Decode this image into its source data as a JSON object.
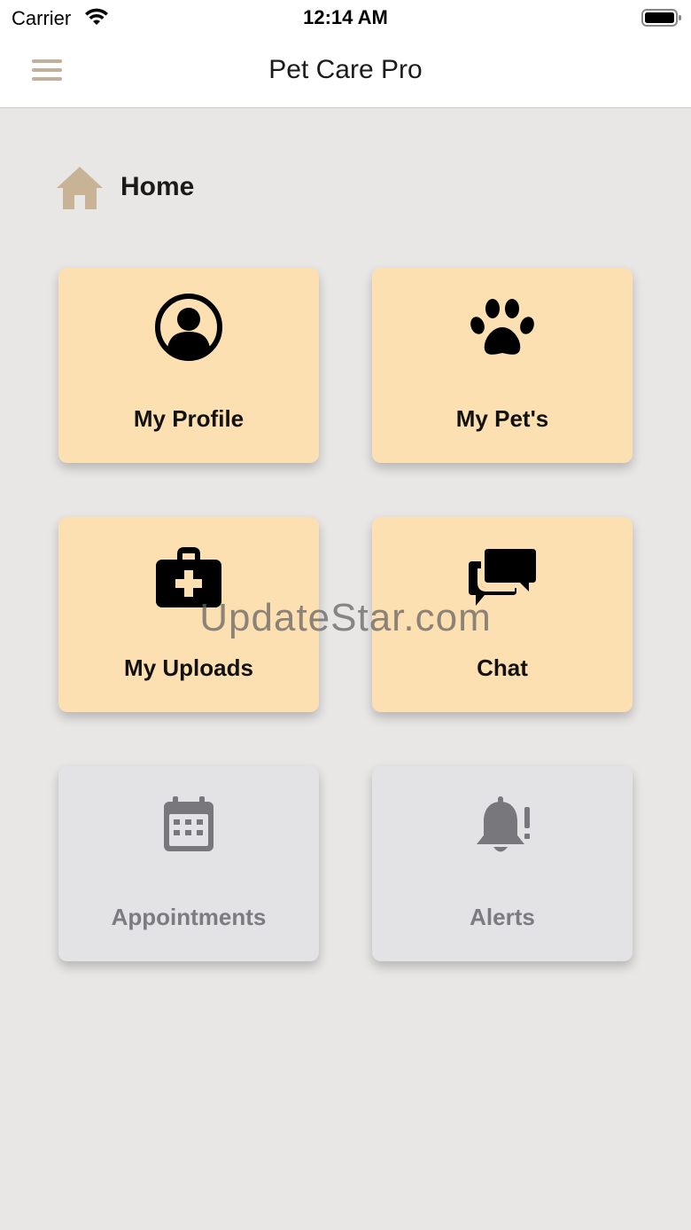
{
  "status_bar": {
    "carrier": "Carrier",
    "time": "12:14 AM"
  },
  "nav": {
    "title": "Pet Care Pro"
  },
  "section": {
    "title": "Home"
  },
  "tiles": [
    {
      "label": "My Profile",
      "icon": "profile-icon",
      "enabled": true
    },
    {
      "label": "My Pet's",
      "icon": "paw-icon",
      "enabled": true
    },
    {
      "label": "My Uploads",
      "icon": "medical-kit-icon",
      "enabled": true
    },
    {
      "label": "Chat",
      "icon": "chat-icon",
      "enabled": true
    },
    {
      "label": "Appointments",
      "icon": "calendar-icon",
      "enabled": false
    },
    {
      "label": "Alerts",
      "icon": "bell-alert-icon",
      "enabled": false
    }
  ],
  "watermark": "UpdateStar.com",
  "colors": {
    "background": "#e8e7e6",
    "tile_active": "#fde0b2",
    "tile_inactive": "#e3e3e6",
    "accent_beige": "#c2b09a",
    "inactive_icon": "#77777c"
  }
}
